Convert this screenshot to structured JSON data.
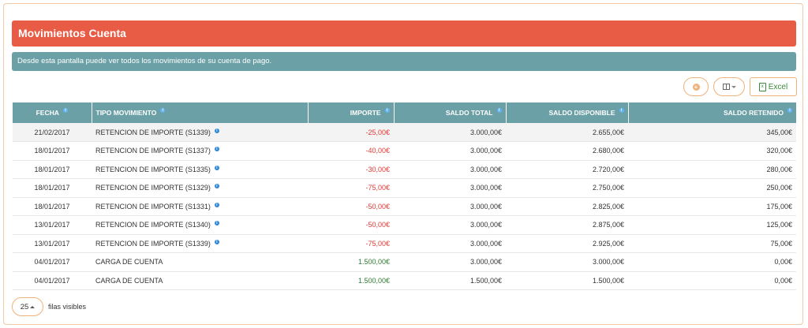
{
  "page": {
    "title": "Movimientos Cuenta",
    "info": "Desde esta pantalla puede ver todos los movimientos de su cuenta de pago."
  },
  "toolbar": {
    "add_icon": "plus-circle-icon",
    "columns_icon": "columns-icon",
    "excel_icon": "excel-file-icon",
    "excel_label": "Excel"
  },
  "table": {
    "headers": [
      "FECHA",
      "TIPO MOVIMIENTO",
      "IMPORTE",
      "SALDO TOTAL",
      "SALDO DISPONIBLE",
      "SALDO RETENIDO"
    ],
    "rows": [
      {
        "fecha": "21/02/2017",
        "tipo": "RETENCION DE IMPORTE (S1339)",
        "info": true,
        "importe": "-25,00€",
        "sign": "neg",
        "total": "3.000,00€",
        "disponible": "2.655,00€",
        "retenido": "345,00€"
      },
      {
        "fecha": "18/01/2017",
        "tipo": "RETENCION DE IMPORTE (S1337)",
        "info": true,
        "importe": "-40,00€",
        "sign": "neg",
        "total": "3.000,00€",
        "disponible": "2.680,00€",
        "retenido": "320,00€"
      },
      {
        "fecha": "18/01/2017",
        "tipo": "RETENCION DE IMPORTE (S1335)",
        "info": true,
        "importe": "-30,00€",
        "sign": "neg",
        "total": "3.000,00€",
        "disponible": "2.720,00€",
        "retenido": "280,00€"
      },
      {
        "fecha": "18/01/2017",
        "tipo": "RETENCION DE IMPORTE (S1329)",
        "info": true,
        "importe": "-75,00€",
        "sign": "neg",
        "total": "3.000,00€",
        "disponible": "2.750,00€",
        "retenido": "250,00€"
      },
      {
        "fecha": "18/01/2017",
        "tipo": "RETENCION DE IMPORTE (S1331)",
        "info": true,
        "importe": "-50,00€",
        "sign": "neg",
        "total": "3.000,00€",
        "disponible": "2.825,00€",
        "retenido": "175,00€"
      },
      {
        "fecha": "13/01/2017",
        "tipo": "RETENCION DE IMPORTE (S1340)",
        "info": true,
        "importe": "-50,00€",
        "sign": "neg",
        "total": "3.000,00€",
        "disponible": "2.875,00€",
        "retenido": "125,00€"
      },
      {
        "fecha": "13/01/2017",
        "tipo": "RETENCION DE IMPORTE (S1339)",
        "info": true,
        "importe": "-75,00€",
        "sign": "neg",
        "total": "3.000,00€",
        "disponible": "2.925,00€",
        "retenido": "75,00€"
      },
      {
        "fecha": "04/01/2017",
        "tipo": "CARGA DE CUENTA",
        "info": false,
        "importe": "1.500,00€",
        "sign": "pos",
        "total": "3.000,00€",
        "disponible": "3.000,00€",
        "retenido": "0,00€"
      },
      {
        "fecha": "04/01/2017",
        "tipo": "CARGA DE CUENTA",
        "info": false,
        "importe": "1.500,00€",
        "sign": "pos",
        "total": "1.500,00€",
        "disponible": "1.500,00€",
        "retenido": "0,00€"
      }
    ]
  },
  "footer": {
    "page_size": "25",
    "rows_label": "filas visibles"
  },
  "colors": {
    "title_bg": "#e85c45",
    "info_bg": "#6aa0a6",
    "header_bg": "#6aa0a6",
    "accent_border": "#f0b27a",
    "negative": "#e53935",
    "positive": "#2e7d32",
    "excel_green": "#3a8a3a"
  }
}
